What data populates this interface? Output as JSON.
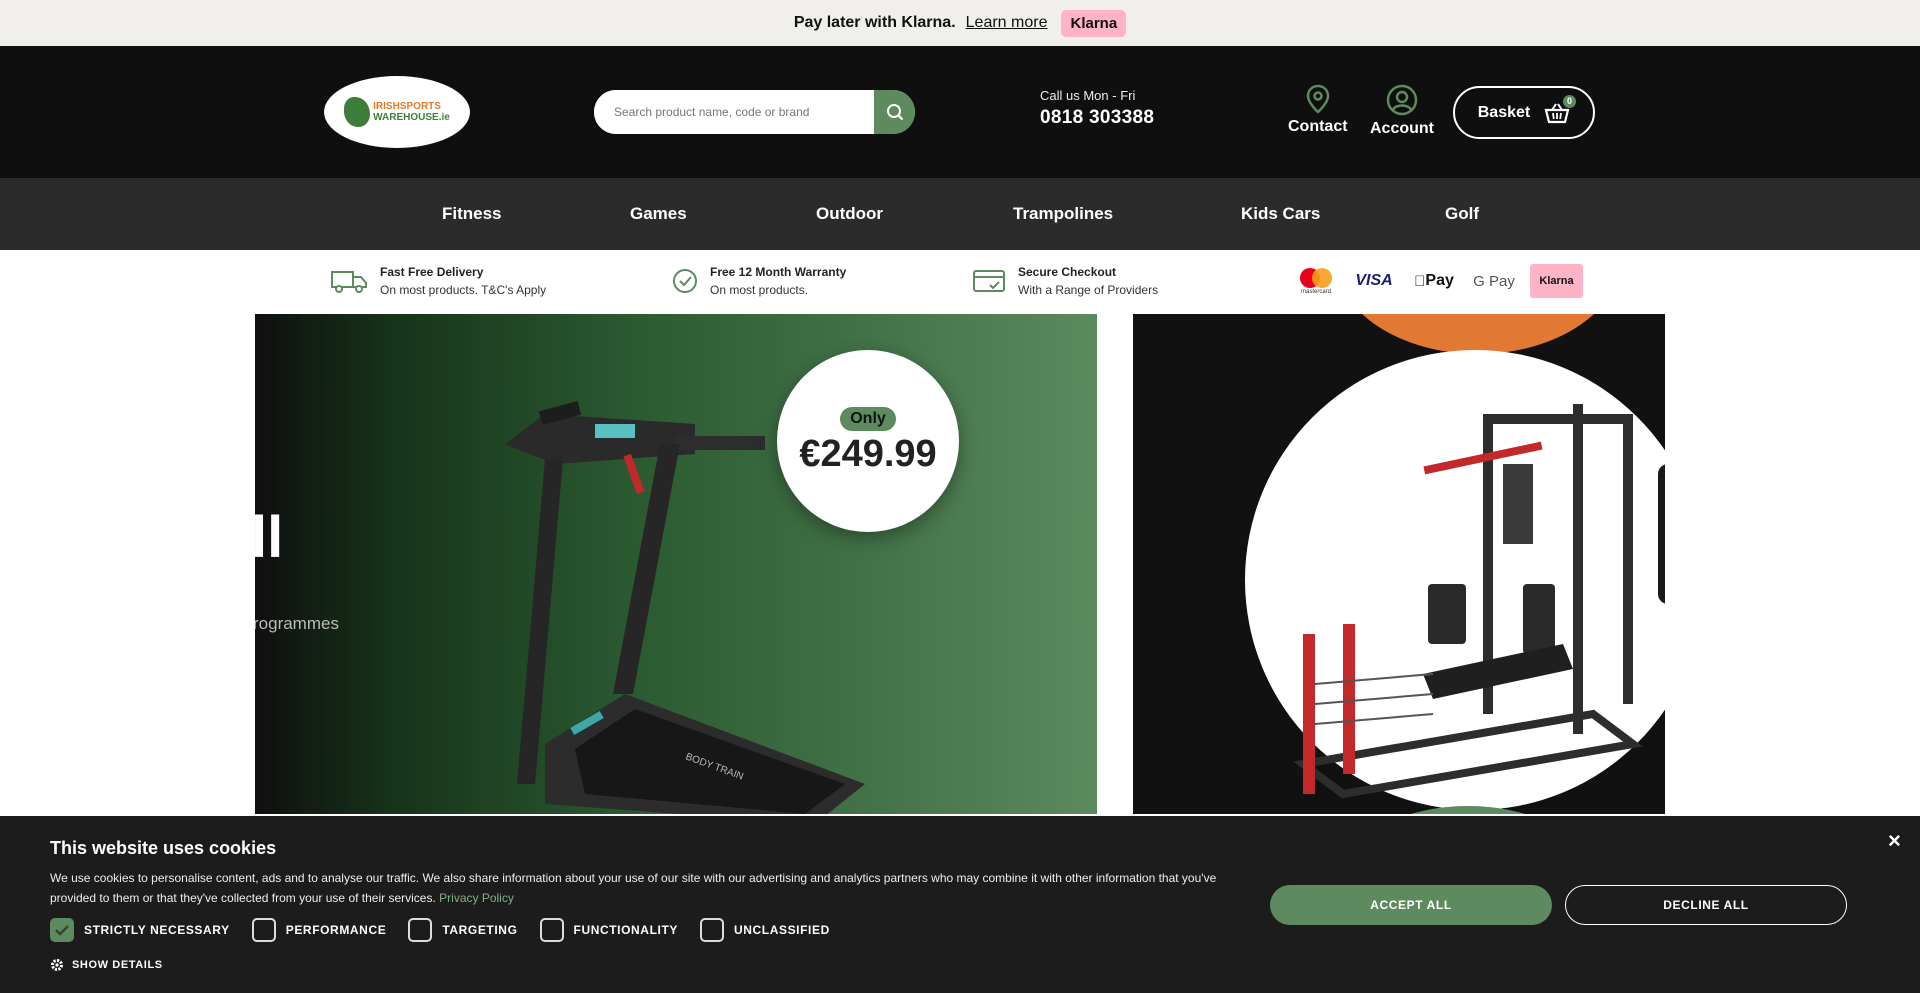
{
  "klarna_banner": {
    "text": "Pay later with Klarna.",
    "link": "Learn more",
    "badge": "Klarna"
  },
  "header": {
    "logo_line1": "IRISHSPORTS",
    "logo_line2": "WAREHOUSE.ie",
    "search_placeholder": "Search product name, code or brand",
    "call_label": "Call us Mon - Fri",
    "phone": "0818 303388",
    "contact_label": "Contact",
    "account_label": "Account",
    "basket_label": "Basket",
    "basket_count": "0"
  },
  "nav": {
    "items": [
      "Fitness",
      "Games",
      "Outdoor",
      "Trampolines",
      "Kids Cars",
      "Golf"
    ]
  },
  "usps": [
    {
      "title": "Fast Free Delivery",
      "subtitle": "On most products. T&C's Apply",
      "icon": "truck-icon"
    },
    {
      "title": "Free 12 Month Warranty",
      "subtitle": "On most products.",
      "icon": "check-circle-icon"
    },
    {
      "title": "Secure Checkout",
      "subtitle": "With a Range of Providers",
      "icon": "card-icon"
    }
  ],
  "payments": {
    "mastercard_label": "mastercard",
    "visa": "VISA",
    "applepay": "Pay",
    "gpay": "G Pay",
    "klarna": "Klarna"
  },
  "hero": {
    "big_text": "ll",
    "sub_text": "rogrammes",
    "badge": "Only",
    "price": "€249.99",
    "product_brand": "BODY TRAIN"
  },
  "cookie": {
    "title": "This website uses cookies",
    "text": "We use cookies to personalise content, ads and to analyse our traffic. We also share information about your use of our site with our advertising and analytics partners who may combine it with other information that you've provided to them or that they've collected from your use of their services.",
    "privacy_link": "Privacy Policy",
    "close": "×",
    "options": [
      "STRICTLY NECESSARY",
      "PERFORMANCE",
      "TARGETING",
      "FUNCTIONALITY",
      "UNCLASSIFIED"
    ],
    "show_details": "SHOW DETAILS",
    "accept": "ACCEPT ALL",
    "decline": "DECLINE ALL"
  },
  "colors": {
    "accent_green": "#5d8a5e",
    "klarna_pink": "#ffb3c7",
    "orange": "#e17934",
    "header_bg": "#0f0f0f"
  }
}
